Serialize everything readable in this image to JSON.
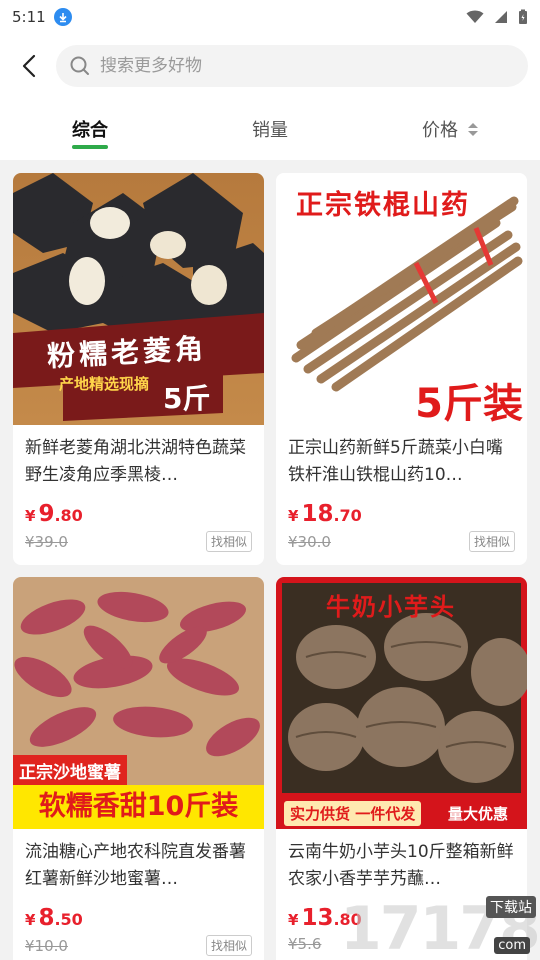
{
  "status": {
    "time": "5:11"
  },
  "search": {
    "placeholder": "搜索更多好物"
  },
  "tabs": [
    {
      "label": "综合"
    },
    {
      "label": "销量"
    },
    {
      "label": "价格"
    }
  ],
  "products": [
    {
      "image_text": {
        "main": "粉糯老菱角",
        "sub": "产地精选现摘",
        "weight": "5斤"
      },
      "title": "新鲜老菱角湖北洪湖特色蔬菜野生凌角应季黑棱…",
      "price_int": "9",
      "price_dec": ".80",
      "currency": "¥",
      "old_price": "¥39.0",
      "similar_label": "找相似"
    },
    {
      "image_text": {
        "main": "正宗铁棍山药",
        "weight": "5斤装"
      },
      "title": "正宗山药新鲜5斤蔬菜小白嘴铁杆淮山铁棍山药10…",
      "price_int": "18",
      "price_dec": ".70",
      "currency": "¥",
      "old_price": "¥30.0",
      "similar_label": "找相似"
    },
    {
      "image_text": {
        "tag": "正宗沙地蜜薯",
        "main": "软糯香甜10斤装"
      },
      "title": "流油糖心产地农科院直发番薯红薯新鲜沙地蜜薯…",
      "price_int": "8",
      "price_dec": ".50",
      "currency": "¥",
      "old_price": "¥10.0",
      "similar_label": "找相似"
    },
    {
      "image_text": {
        "main": "牛奶小芋头",
        "bottom_left": "实力供货 一件代发",
        "bottom_right": "量大优惠"
      },
      "title": "云南牛奶小芋头10斤整箱新鲜农家小香芋芋艿蘸…",
      "price_int": "13",
      "price_dec": ".80",
      "currency": "¥",
      "old_price": "¥5.6",
      "similar_label": ""
    }
  ],
  "watermark": {
    "number": "17178",
    "label": "下载站",
    "logo": "com"
  },
  "colors": {
    "accent_green": "#2eaa4a",
    "price_red": "#e8202c"
  }
}
